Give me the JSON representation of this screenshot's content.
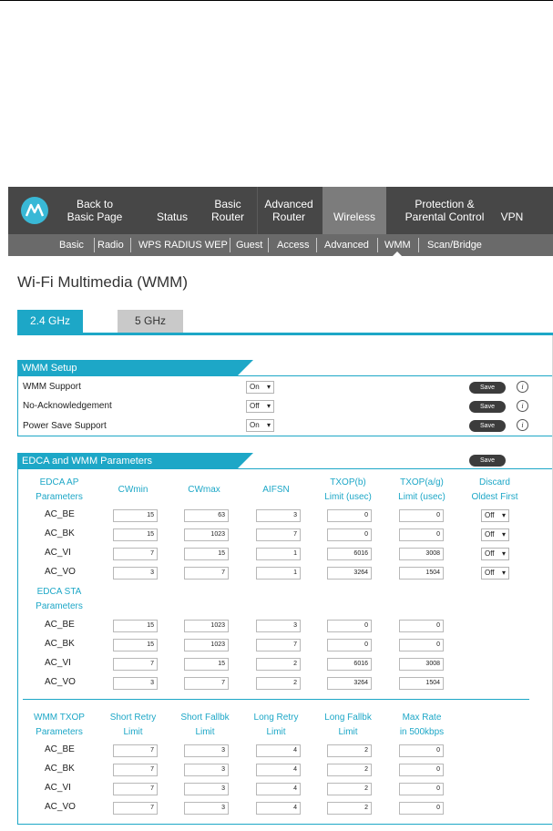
{
  "nav": {
    "items": [
      {
        "label1": "Back to",
        "label2": "Basic Page"
      },
      {
        "label1": "",
        "label2": "Status"
      },
      {
        "label1": "Basic",
        "label2": "Router"
      },
      {
        "label1": "Advanced",
        "label2": "Router"
      },
      {
        "label1": "",
        "label2": "Wireless"
      },
      {
        "label1": "Protection &",
        "label2": "Parental Control"
      },
      {
        "label1": "",
        "label2": "VPN"
      }
    ],
    "active": "Wireless"
  },
  "subnav": {
    "items": [
      "Basic",
      "Radio",
      "WPS RADIUS WEP",
      "Guest",
      "Access",
      "Advanced",
      "WMM",
      "Scan/Bridge"
    ],
    "current": "WMM"
  },
  "page_title": "Wi-Fi Multimedia (WMM)",
  "tabs": {
    "active": "2.4 GHz",
    "inactive": "5 GHz"
  },
  "wmm_setup": {
    "title": "WMM Setup",
    "rows": [
      {
        "label": "WMM Support",
        "value": "On",
        "save": "Save"
      },
      {
        "label": "No-Acknowledgement",
        "value": "Off",
        "save": "Save"
      },
      {
        "label": "Power Save Support",
        "value": "On",
        "save": "Save"
      }
    ],
    "info_icon": "i"
  },
  "edca": {
    "title": "EDCA and WMM Parameters",
    "save": "Save",
    "headers": [
      {
        "l1": "EDCA AP",
        "l2": "Parameters"
      },
      {
        "l1": "CWmin",
        "l2": ""
      },
      {
        "l1": "CWmax",
        "l2": ""
      },
      {
        "l1": "AIFSN",
        "l2": ""
      },
      {
        "l1": "TXOP(b)",
        "l2": "Limit (usec)"
      },
      {
        "l1": "TXOP(a/g)",
        "l2": "Limit (usec)"
      },
      {
        "l1": "Discard",
        "l2": "Oldest First"
      }
    ],
    "ap_rows": [
      {
        "name": "AC_BE",
        "cwmin": "15",
        "cwmax": "63",
        "aifsn": "3",
        "txopb": "0",
        "txopag": "0",
        "discard": "Off"
      },
      {
        "name": "AC_BK",
        "cwmin": "15",
        "cwmax": "1023",
        "aifsn": "7",
        "txopb": "0",
        "txopag": "0",
        "discard": "Off"
      },
      {
        "name": "AC_VI",
        "cwmin": "7",
        "cwmax": "15",
        "aifsn": "1",
        "txopb": "6016",
        "txopag": "3008",
        "discard": "Off"
      },
      {
        "name": "AC_VO",
        "cwmin": "3",
        "cwmax": "7",
        "aifsn": "1",
        "txopb": "3264",
        "txopag": "1504",
        "discard": "Off"
      }
    ],
    "sta_header": {
      "l1": "EDCA STA",
      "l2": "Parameters"
    },
    "sta_rows": [
      {
        "name": "AC_BE",
        "cwmin": "15",
        "cwmax": "1023",
        "aifsn": "3",
        "txopb": "0",
        "txopag": "0"
      },
      {
        "name": "AC_BK",
        "cwmin": "15",
        "cwmax": "1023",
        "aifsn": "7",
        "txopb": "0",
        "txopag": "0"
      },
      {
        "name": "AC_VI",
        "cwmin": "7",
        "cwmax": "15",
        "aifsn": "2",
        "txopb": "6016",
        "txopag": "3008"
      },
      {
        "name": "AC_VO",
        "cwmin": "3",
        "cwmax": "7",
        "aifsn": "2",
        "txopb": "3264",
        "txopag": "1504"
      }
    ]
  },
  "txop": {
    "headers": [
      {
        "l1": "WMM TXOP",
        "l2": "Parameters"
      },
      {
        "l1": "Short Retry",
        "l2": "Limit"
      },
      {
        "l1": "Short Fallbk",
        "l2": "Limit"
      },
      {
        "l1": "Long Retry",
        "l2": "Limit"
      },
      {
        "l1": "Long Fallbk",
        "l2": "Limit"
      },
      {
        "l1": "Max Rate",
        "l2": "in 500kbps"
      }
    ],
    "rows": [
      {
        "name": "AC_BE",
        "sretry": "7",
        "sfall": "3",
        "lretry": "4",
        "lfall": "2",
        "maxrate": "0"
      },
      {
        "name": "AC_BK",
        "sretry": "7",
        "sfall": "3",
        "lretry": "4",
        "lfall": "2",
        "maxrate": "0"
      },
      {
        "name": "AC_VI",
        "sretry": "7",
        "sfall": "3",
        "lretry": "4",
        "lfall": "2",
        "maxrate": "0"
      },
      {
        "name": "AC_VO",
        "sretry": "7",
        "sfall": "3",
        "lretry": "4",
        "lfall": "2",
        "maxrate": "0"
      }
    ]
  },
  "colors": {
    "accent": "#1da7c7",
    "nav": "#474747",
    "subnav": "#6a6a6a",
    "active_tab": "#7c7c7c"
  },
  "icons": {
    "logo": "motorola-logo-icon",
    "info": "info-icon",
    "dropdown": "chevron-down-icon"
  }
}
